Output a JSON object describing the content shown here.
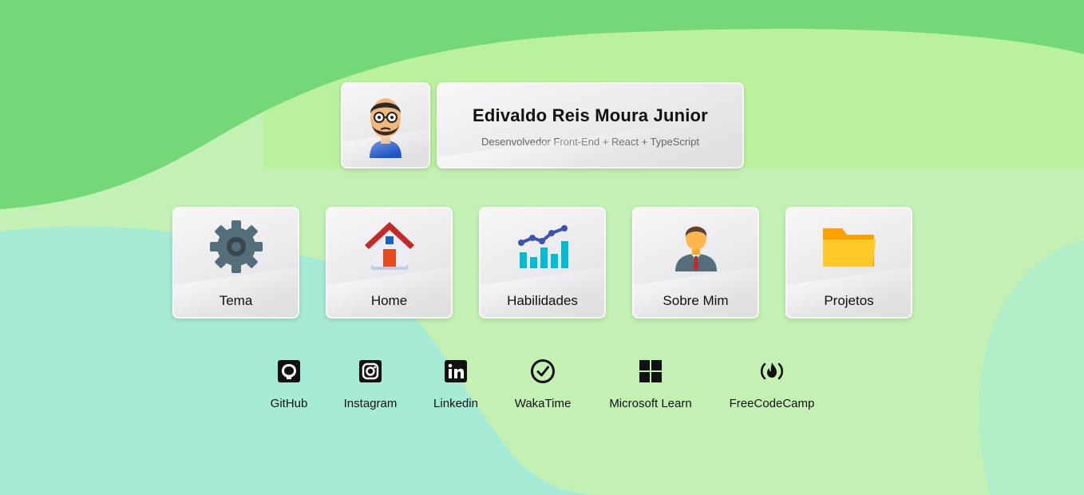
{
  "profile": {
    "name": "Edivaldo Reis Moura Junior",
    "subtitle": "Desenvolvedor Front-End + React + TypeScript"
  },
  "menu": [
    {
      "label": "Tema",
      "icon": "gear-icon"
    },
    {
      "label": "Home",
      "icon": "house-icon"
    },
    {
      "label": "Habilidades",
      "icon": "chart-icon"
    },
    {
      "label": "Sobre Mim",
      "icon": "person-icon"
    },
    {
      "label": "Projetos",
      "icon": "folder-icon"
    }
  ],
  "social": [
    {
      "label": "GitHub",
      "icon": "github-icon"
    },
    {
      "label": "Instagram",
      "icon": "instagram-icon"
    },
    {
      "label": "Linkedin",
      "icon": "linkedin-icon"
    },
    {
      "label": "WakaTime",
      "icon": "wakatime-icon"
    },
    {
      "label": "Microsoft Learn",
      "icon": "microsoft-icon"
    },
    {
      "label": "FreeCodeCamp",
      "icon": "freecodecamp-icon"
    }
  ],
  "colors": {
    "bg_dark_green": "#74d878",
    "bg_light_green": "#b9f19a",
    "bg_mint": "#a6ebd6",
    "text": "#111111",
    "subtitle": "#666666"
  }
}
